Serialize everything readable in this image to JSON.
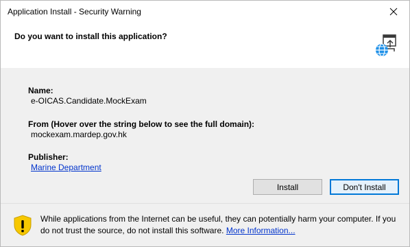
{
  "window": {
    "title": "Application Install - Security Warning"
  },
  "header": {
    "question": "Do you want to install this application?"
  },
  "details": {
    "name_label": "Name:",
    "name_value": "e-OICAS.Candidate.MockExam",
    "from_label": "From (Hover over the string below to see the full domain):",
    "from_value": "mockexam.mardep.gov.hk",
    "publisher_label": "Publisher:",
    "publisher_value": "Marine Department"
  },
  "buttons": {
    "install": "Install",
    "dont_install": "Don't Install"
  },
  "footer": {
    "warning_text": "While applications from the Internet can be useful, they can potentially harm your computer. If you do not trust the source, do not install this software.",
    "more_info_link": "More Information..."
  },
  "colors": {
    "link": "#0033cc",
    "default_button_border": "#0078d7",
    "shield_yellow": "#f7c800",
    "body_gray": "#f0f0f0"
  },
  "icons": [
    "close-icon",
    "application-globe-icon",
    "warning-shield-icon"
  ]
}
